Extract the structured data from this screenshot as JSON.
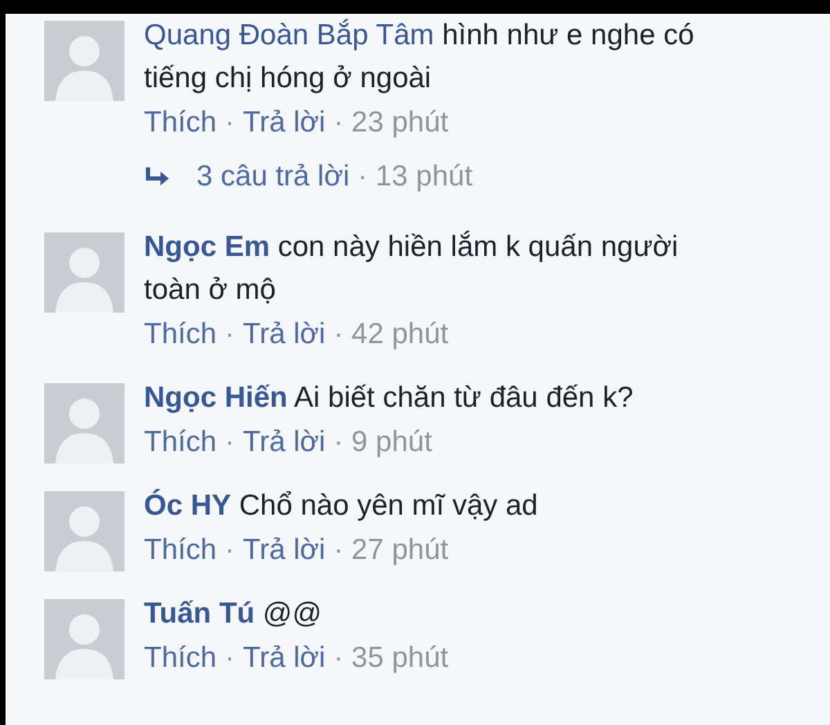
{
  "comments": [
    {
      "name": "Quang Đoàn Bắp Tâm",
      "name_bold": false,
      "text": "hình như e nghe có tiếng chị hóng ở ngoài",
      "like": "Thích",
      "sep": "·",
      "reply": "Trả lời",
      "time": "· 23 phút",
      "replies": {
        "label": "3 câu trả lời",
        "time": "· 13 phút"
      }
    },
    {
      "name": "Ngọc Em",
      "name_bold": true,
      "text": "con này hiền lắm k quấn người toàn ở mộ",
      "like": "Thích",
      "sep": "·",
      "reply": "Trả lời",
      "time": "· 42 phút"
    },
    {
      "name": "Ngọc Hiến",
      "name_bold": true,
      "text": "Ai biết chăn từ đâu đến k?",
      "like": "Thích",
      "sep": "·",
      "reply": "Trả lời",
      "time": "· 9 phút"
    },
    {
      "name": "Óc HY",
      "name_bold": true,
      "text": "Chổ nào yên mĩ vậy ad",
      "like": "Thích",
      "sep": "·",
      "reply": "Trả lời",
      "time": "· 27 phút"
    },
    {
      "name": "Tuấn Tú",
      "name_bold": true,
      "text": "@@",
      "like": "Thích",
      "sep": "·",
      "reply": "Trả lời",
      "time": "· 35 phút"
    }
  ]
}
